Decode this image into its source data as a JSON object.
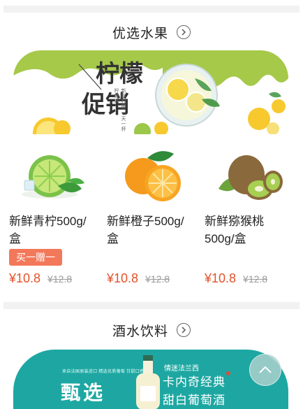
{
  "sections": {
    "fruit": {
      "title": "优选水果"
    },
    "drinks": {
      "title": "酒水饮料"
    }
  },
  "banner_lemon": {
    "title_line1": "柠檬",
    "title_line2": "促销",
    "vertical_text": "新鲜柠檬 一天一杯柠檬水"
  },
  "products": [
    {
      "name": "新鲜青柠500g/盒",
      "badge": "买一赠一",
      "price": "¥10.8",
      "old_price": "¥12.8",
      "image": "lime"
    },
    {
      "name": "新鲜橙子500g/盒",
      "badge": "",
      "price": "¥10.8",
      "old_price": "¥12.8",
      "image": "orange"
    },
    {
      "name": "新鲜猕猴桃500g/盒",
      "badge": "",
      "price": "¥10.8",
      "old_price": "¥12.8",
      "image": "kiwi"
    }
  ],
  "banner_wine": {
    "big_text": "甄选",
    "small_text": "来自法国原装进口 精选优质葡萄 甘甜口感",
    "subtitle": "情迷法兰西",
    "line1": "卡内奇经典",
    "line2": "甜白葡萄酒"
  },
  "icons": {
    "section_arrow": "chevron-right-circle-icon",
    "back_to_top": "chevron-up-icon"
  },
  "colors": {
    "price": "#e3522a",
    "badge": "#f3785a",
    "banner_green": "#a6c94a",
    "banner_teal": "#1ea7a2"
  }
}
